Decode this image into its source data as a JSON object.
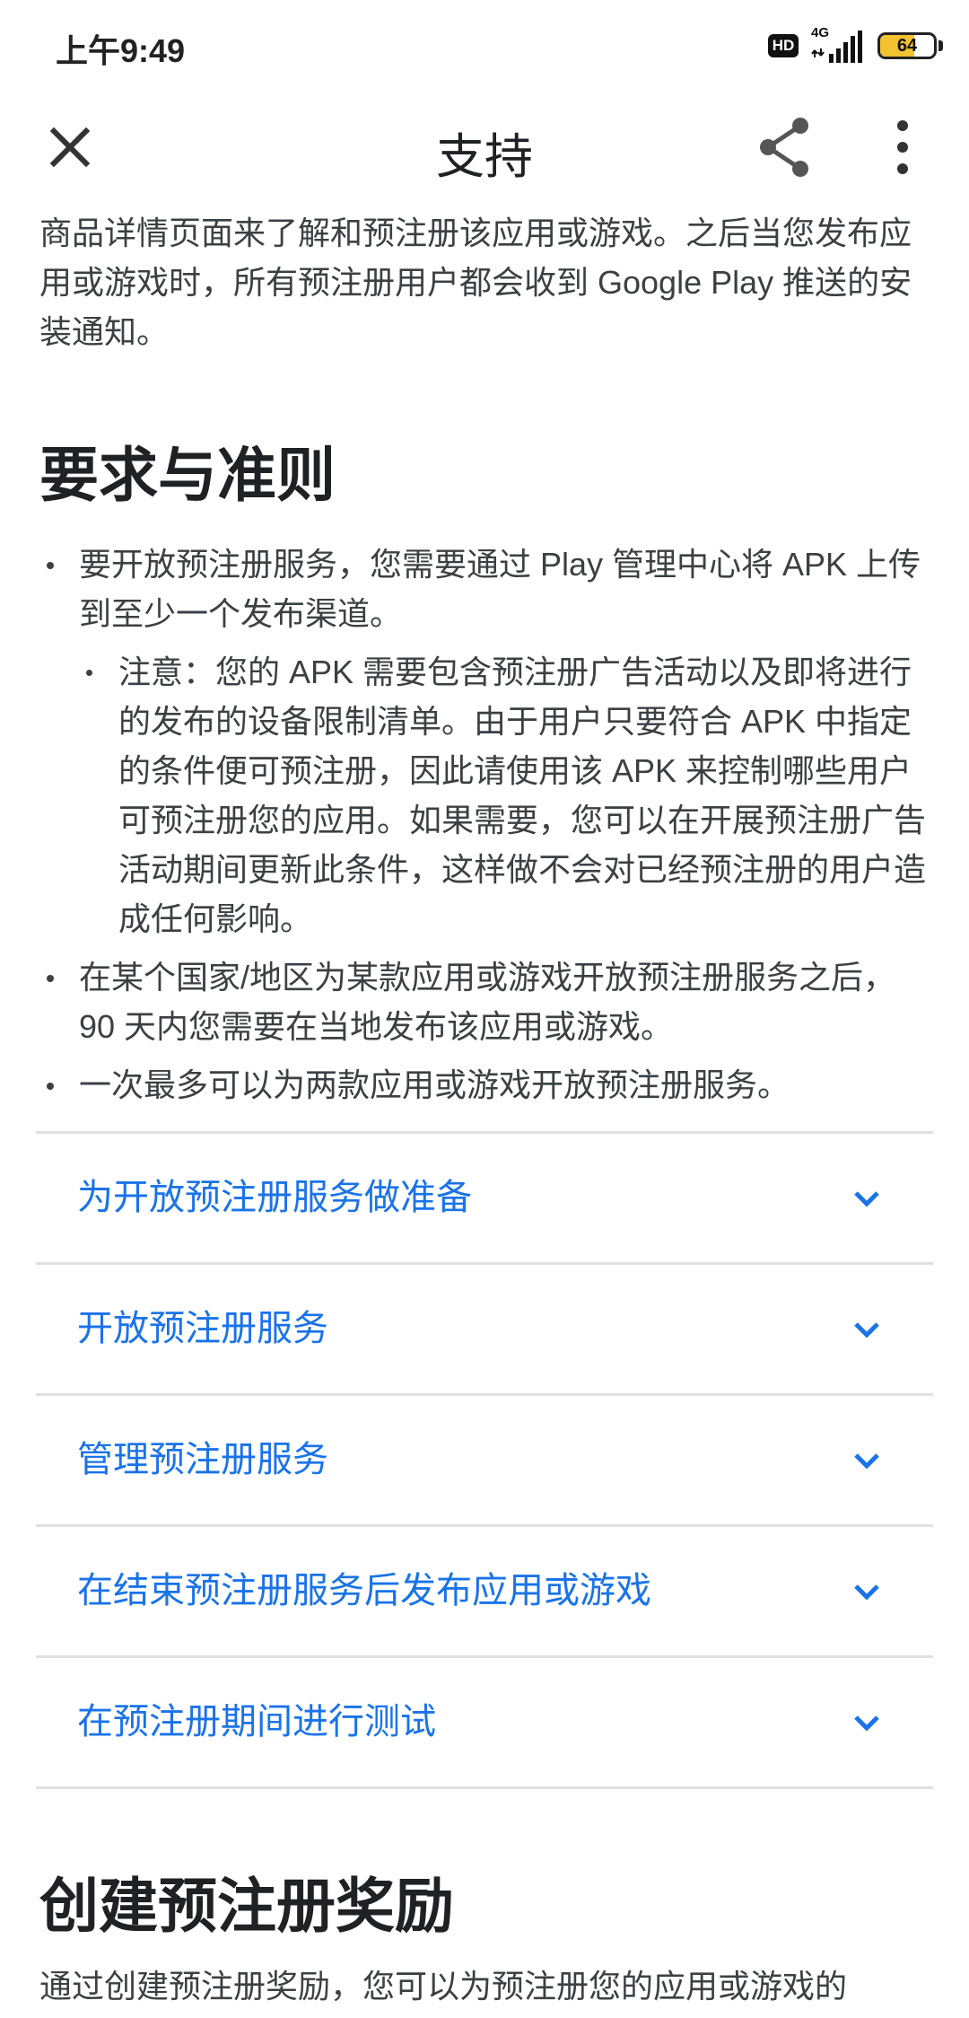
{
  "status_bar": {
    "time": "上午9:49",
    "hd_badge": "HD",
    "network": "4G",
    "battery": "64",
    "battery_level": 0.64
  },
  "app_bar": {
    "title": "支持",
    "close_icon": "close-icon",
    "share_icon": "share-icon",
    "more_icon": "more-vert-icon"
  },
  "content": {
    "intro": "商品详情页面来了解和预注册该应用或游戏。之后当您发布应用或游戏时，所有预注册用户都会收到 Google Play 推送的安装通知。",
    "section_heading": "要求与准则",
    "bullets": [
      "要开放预注册服务，您需要通过 Play 管理中心将 APK 上传到至少一个发布渠道。",
      "在某个国家/地区为某款应用或游戏开放预注册服务之后，90 天内您需要在当地发布该应用或游戏。",
      "一次最多可以为两款应用或游戏开放预注册服务。"
    ],
    "sub_bullet": "注意：您的 APK 需要包含预注册广告活动以及即将进行的发布的设备限制清单。由于用户只要符合 APK 中指定的条件便可预注册，因此请使用该 APK 来控制哪些用户可预注册您的应用。如果需要，您可以在开展预注册广告活动期间更新此条件，这样做不会对已经预注册的用户造成任何影响。",
    "accordion": [
      "为开放预注册服务做准备",
      "开放预注册服务",
      "管理预注册服务",
      "在结束预注册服务后发布应用或游戏",
      "在预注册期间进行测试"
    ],
    "section_heading_2": "创建预注册奖励",
    "outro": "通过创建预注册奖励，您可以为预注册您的应用或游戏的"
  },
  "colors": {
    "link": "#1a73e8",
    "text": "#3c4043",
    "heading": "#202124",
    "divider": "#e0e0e0"
  }
}
